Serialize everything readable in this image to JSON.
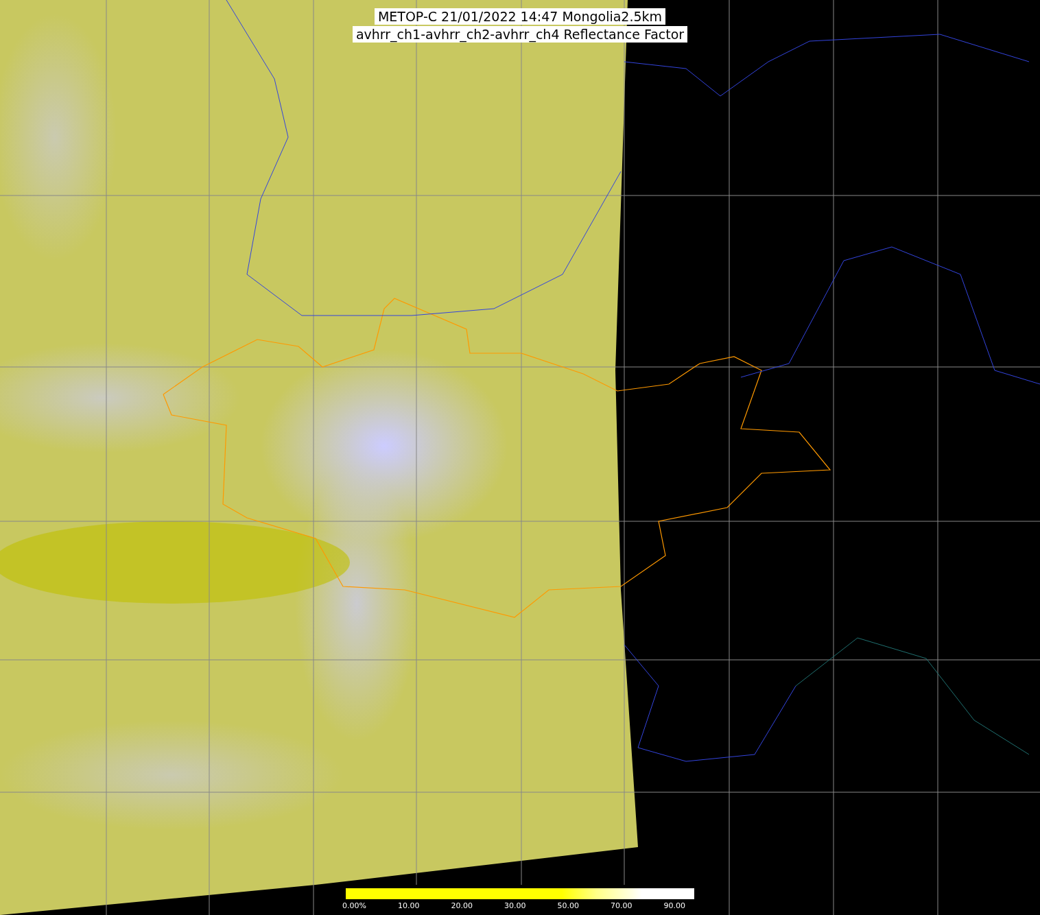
{
  "title": {
    "line_1": "METOP-C 21/01/2022 14:47 Mongolia2.5km",
    "line_2": "avhrr_ch1-avhrr_ch2-avhrr_ch4 Reflectance Factor"
  },
  "colorbar": {
    "tick_labels": [
      "0.00%",
      "10.00",
      "20.00",
      "30.00",
      "50.00",
      "70.00",
      "90.00"
    ]
  }
}
